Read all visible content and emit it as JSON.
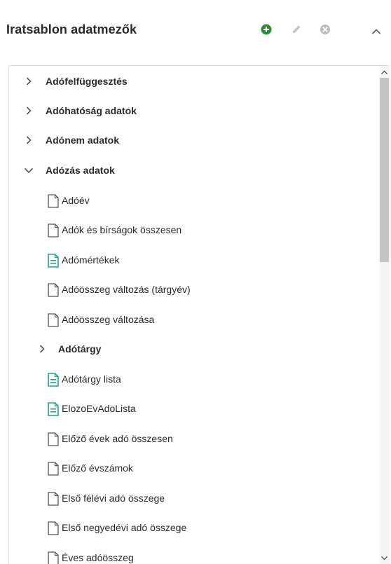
{
  "header": {
    "title": "Iratsablon adatmezők",
    "add_icon": "plus-circle-icon",
    "edit_icon": "pencil-icon",
    "delete_icon": "x-circle-icon",
    "collapse_icon": "chevron-up-icon"
  },
  "colors": {
    "accent_green": "#2e8b3c",
    "teal_doc": "#1aa68a",
    "muted_gray": "#bdbdbd",
    "outline": "#555555"
  },
  "tree": {
    "items": [
      {
        "label": "Adófelfüggesztés",
        "kind": "folder",
        "state": "collapsed"
      },
      {
        "label": "Adóhatóság adatok",
        "kind": "folder",
        "state": "collapsed"
      },
      {
        "label": "Adónem adatok",
        "kind": "folder",
        "state": "collapsed"
      },
      {
        "label": "Adózás adatok",
        "kind": "folder",
        "state": "expanded"
      },
      {
        "label": "Adóév",
        "kind": "field",
        "icon": "document-icon"
      },
      {
        "label": "Adók és bírságok összesen",
        "kind": "field",
        "icon": "document-icon"
      },
      {
        "label": "Adómértékek",
        "kind": "list",
        "icon": "list-document-icon"
      },
      {
        "label": "Adóösszeg változás (tárgyév)",
        "kind": "field",
        "icon": "document-icon"
      },
      {
        "label": "Adóösszeg változása",
        "kind": "field",
        "icon": "document-icon"
      },
      {
        "label": "Adótárgy",
        "kind": "folder",
        "state": "collapsed"
      },
      {
        "label": "Adótárgy lista",
        "kind": "list",
        "icon": "list-document-icon"
      },
      {
        "label": "ElozoEvAdoLista",
        "kind": "list",
        "icon": "list-document-icon"
      },
      {
        "label": "Előző évek adó összesen",
        "kind": "field",
        "icon": "document-icon"
      },
      {
        "label": "Előző évszámok",
        "kind": "field",
        "icon": "document-icon"
      },
      {
        "label": "Első félévi adó összege",
        "kind": "field",
        "icon": "document-icon"
      },
      {
        "label": "Első negyedévi adó összege",
        "kind": "field",
        "icon": "document-icon"
      },
      {
        "label": "Éves adóösszeg",
        "kind": "field",
        "icon": "document-icon"
      }
    ]
  }
}
